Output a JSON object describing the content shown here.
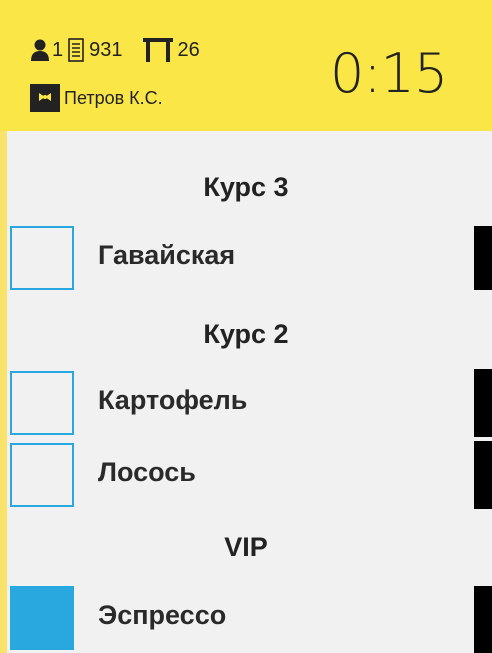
{
  "header": {
    "guests_count": "1",
    "check_number": "931",
    "table_number": "26",
    "waiter_name": "Петров К.С.",
    "timer": "0:15",
    "background_color": "#fae646",
    "icons": {
      "guests": "person-icon",
      "check": "receipt-icon",
      "table": "table-icon",
      "waiter": "waiter-icon"
    }
  },
  "order": {
    "groups": [
      {
        "title": "Курс 3",
        "items": [
          {
            "name": "Гавайская",
            "checked": false
          }
        ]
      },
      {
        "title": "Курс 2",
        "items": [
          {
            "name": "Картофель",
            "checked": false
          },
          {
            "name": "Лосось",
            "checked": false
          }
        ]
      },
      {
        "title": "VIP",
        "items": [
          {
            "name": "Эспрессо",
            "checked": true
          }
        ]
      }
    ],
    "accent_color": "#29a7df"
  }
}
